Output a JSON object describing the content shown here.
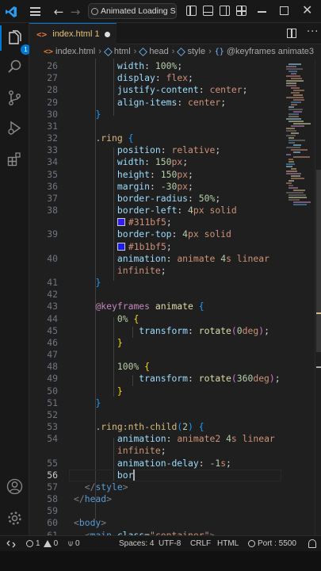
{
  "titlebar": {
    "search_text": "Animated Loading Scre"
  },
  "activity": {
    "explorer_badge": "1"
  },
  "tab": {
    "icon": "<>",
    "name": "index.html 1"
  },
  "breadcrumb": {
    "items": [
      "index.html",
      "html",
      "head",
      "style",
      "@keyframes animate3"
    ]
  },
  "editor": {
    "current_line": 56,
    "lines": [
      {
        "n": "26",
        "segs": [
          [
            "",
            "        "
          ],
          [
            "p",
            "width"
          ],
          [
            "pc",
            ": "
          ],
          [
            "n",
            "100"
          ],
          [
            "u",
            "%"
          ],
          [
            "pc",
            ";"
          ]
        ]
      },
      {
        "n": "27",
        "segs": [
          [
            "",
            "        "
          ],
          [
            "p",
            "display"
          ],
          [
            "pc",
            ": "
          ],
          [
            "v",
            "flex"
          ],
          [
            "pc",
            ";"
          ]
        ]
      },
      {
        "n": "28",
        "segs": [
          [
            "",
            "        "
          ],
          [
            "p",
            "justify-content"
          ],
          [
            "pc",
            ": "
          ],
          [
            "v",
            "center"
          ],
          [
            "pc",
            ";"
          ]
        ]
      },
      {
        "n": "29",
        "segs": [
          [
            "",
            "        "
          ],
          [
            "p",
            "align-items"
          ],
          [
            "pc",
            ": "
          ],
          [
            "v",
            "center"
          ],
          [
            "pc",
            ";"
          ]
        ]
      },
      {
        "n": "30",
        "segs": [
          [
            "",
            "    "
          ],
          [
            "b3",
            "}"
          ]
        ]
      },
      {
        "n": "31",
        "segs": []
      },
      {
        "n": "32",
        "segs": [
          [
            "",
            "    "
          ],
          [
            "sel",
            ".ring"
          ],
          [
            "pc",
            " "
          ],
          [
            "b3",
            "{"
          ]
        ]
      },
      {
        "n": "33",
        "segs": [
          [
            "",
            "        "
          ],
          [
            "p",
            "position"
          ],
          [
            "pc",
            ": "
          ],
          [
            "v",
            "relative"
          ],
          [
            "pc",
            ";"
          ]
        ]
      },
      {
        "n": "34",
        "segs": [
          [
            "",
            "        "
          ],
          [
            "p",
            "width"
          ],
          [
            "pc",
            ": "
          ],
          [
            "n",
            "150"
          ],
          [
            "v",
            "px"
          ],
          [
            "pc",
            ";"
          ]
        ]
      },
      {
        "n": "35",
        "segs": [
          [
            "",
            "        "
          ],
          [
            "p",
            "height"
          ],
          [
            "pc",
            ": "
          ],
          [
            "n",
            "150"
          ],
          [
            "v",
            "px"
          ],
          [
            "pc",
            ";"
          ]
        ]
      },
      {
        "n": "36",
        "segs": [
          [
            "",
            "        "
          ],
          [
            "p",
            "margin"
          ],
          [
            "pc",
            ": "
          ],
          [
            "n",
            "-30"
          ],
          [
            "v",
            "px"
          ],
          [
            "pc",
            ";"
          ]
        ]
      },
      {
        "n": "37",
        "segs": [
          [
            "",
            "        "
          ],
          [
            "p",
            "border-radius"
          ],
          [
            "pc",
            ": "
          ],
          [
            "n",
            "50"
          ],
          [
            "u",
            "%"
          ],
          [
            "pc",
            ";"
          ]
        ]
      },
      {
        "n": "38",
        "segs": [
          [
            "",
            "        "
          ],
          [
            "p",
            "border-left"
          ],
          [
            "pc",
            ": "
          ],
          [
            "n",
            "4"
          ],
          [
            "v",
            "px"
          ],
          [
            "pc",
            " "
          ],
          [
            "v",
            "solid"
          ]
        ]
      },
      {
        "n": "",
        "segs": [
          [
            "",
            "        "
          ],
          [
            "swatch",
            "#311bf5"
          ],
          [
            "v",
            "#311bf5"
          ],
          [
            "pc",
            ";"
          ]
        ]
      },
      {
        "n": "39",
        "segs": [
          [
            "",
            "        "
          ],
          [
            "p",
            "border-top"
          ],
          [
            "pc",
            ": "
          ],
          [
            "n",
            "4"
          ],
          [
            "v",
            "px"
          ],
          [
            "pc",
            " "
          ],
          [
            "v",
            "solid"
          ]
        ]
      },
      {
        "n": "",
        "segs": [
          [
            "",
            "        "
          ],
          [
            "swatch",
            "#1b1bf5"
          ],
          [
            "v",
            "#1b1bf5"
          ],
          [
            "pc",
            ";"
          ]
        ]
      },
      {
        "n": "40",
        "segs": [
          [
            "",
            "        "
          ],
          [
            "p",
            "animation"
          ],
          [
            "pc",
            ": "
          ],
          [
            "v",
            "animate"
          ],
          [
            "pc",
            " "
          ],
          [
            "n",
            "4"
          ],
          [
            "v",
            "s"
          ],
          [
            "pc",
            " "
          ],
          [
            "v",
            "linear"
          ]
        ]
      },
      {
        "n": "",
        "segs": [
          [
            "",
            "        "
          ],
          [
            "v",
            "infinite"
          ],
          [
            "pc",
            ";"
          ]
        ]
      },
      {
        "n": "41",
        "segs": [
          [
            "",
            "    "
          ],
          [
            "b3",
            "}"
          ]
        ]
      },
      {
        "n": "42",
        "segs": []
      },
      {
        "n": "43",
        "segs": [
          [
            "",
            "    "
          ],
          [
            "kw",
            "@keyframes"
          ],
          [
            "pc",
            " "
          ],
          [
            "fn",
            "animate"
          ],
          [
            "pc",
            " "
          ],
          [
            "b3",
            "{"
          ]
        ]
      },
      {
        "n": "44",
        "segs": [
          [
            "",
            "        "
          ],
          [
            "n",
            "0"
          ],
          [
            "u",
            "%"
          ],
          [
            "pc",
            " "
          ],
          [
            "b1",
            "{"
          ]
        ]
      },
      {
        "n": "45",
        "segs": [
          [
            "",
            "            "
          ],
          [
            "p",
            "transform"
          ],
          [
            "pc",
            ": "
          ],
          [
            "fn",
            "rotate"
          ],
          [
            "b2",
            "("
          ],
          [
            "n",
            "0"
          ],
          [
            "v",
            "deg"
          ],
          [
            "b2",
            ")"
          ],
          [
            "pc",
            ";"
          ]
        ]
      },
      {
        "n": "46",
        "segs": [
          [
            "",
            "        "
          ],
          [
            "b1",
            "}"
          ]
        ]
      },
      {
        "n": "47",
        "segs": []
      },
      {
        "n": "48",
        "segs": [
          [
            "",
            "        "
          ],
          [
            "n",
            "100"
          ],
          [
            "u",
            "%"
          ],
          [
            "pc",
            " "
          ],
          [
            "b1",
            "{"
          ]
        ]
      },
      {
        "n": "49",
        "segs": [
          [
            "",
            "            "
          ],
          [
            "p",
            "transform"
          ],
          [
            "pc",
            ": "
          ],
          [
            "fn",
            "rotate"
          ],
          [
            "b2",
            "("
          ],
          [
            "n",
            "360"
          ],
          [
            "v",
            "deg"
          ],
          [
            "b2",
            ")"
          ],
          [
            "pc",
            ";"
          ]
        ]
      },
      {
        "n": "50",
        "segs": [
          [
            "",
            "        "
          ],
          [
            "b1",
            "}"
          ]
        ]
      },
      {
        "n": "51",
        "segs": [
          [
            "",
            "    "
          ],
          [
            "b3",
            "}"
          ]
        ]
      },
      {
        "n": "52",
        "segs": []
      },
      {
        "n": "53",
        "segs": [
          [
            "",
            "    "
          ],
          [
            "sel",
            ".ring:nth-child"
          ],
          [
            "b3",
            "("
          ],
          [
            "n",
            "2"
          ],
          [
            "b3",
            ")"
          ],
          [
            "pc",
            " "
          ],
          [
            "b3",
            "{"
          ]
        ]
      },
      {
        "n": "54",
        "segs": [
          [
            "",
            "        "
          ],
          [
            "p",
            "animation"
          ],
          [
            "pc",
            ": "
          ],
          [
            "v",
            "animate2"
          ],
          [
            "pc",
            " "
          ],
          [
            "n",
            "4"
          ],
          [
            "v",
            "s"
          ],
          [
            "pc",
            " "
          ],
          [
            "v",
            "linear"
          ]
        ]
      },
      {
        "n": "",
        "segs": [
          [
            "",
            "        "
          ],
          [
            "v",
            "infinite"
          ],
          [
            "pc",
            ";"
          ]
        ]
      },
      {
        "n": "55",
        "segs": [
          [
            "",
            "        "
          ],
          [
            "p",
            "animation-delay"
          ],
          [
            "pc",
            ": "
          ],
          [
            "n",
            "-1"
          ],
          [
            "v",
            "s"
          ],
          [
            "pc",
            ";"
          ]
        ]
      },
      {
        "n": "56",
        "segs": [
          [
            "",
            "        "
          ],
          [
            "p",
            "bor"
          ],
          [
            "caret",
            ""
          ]
        ]
      },
      {
        "n": "57",
        "segs": [
          [
            "",
            "  "
          ],
          [
            "tag",
            "</"
          ],
          [
            "tn",
            "style"
          ],
          [
            "tag",
            ">"
          ]
        ]
      },
      {
        "n": "58",
        "segs": [
          [
            "tag",
            "</"
          ],
          [
            "tn",
            "head"
          ],
          [
            "tag",
            ">"
          ]
        ]
      },
      {
        "n": "59",
        "segs": []
      },
      {
        "n": "60",
        "segs": [
          [
            "tag",
            "<"
          ],
          [
            "tn",
            "body"
          ],
          [
            "tag",
            ">"
          ]
        ]
      },
      {
        "n": "61",
        "segs": [
          [
            "",
            "  "
          ],
          [
            "tag",
            "<"
          ],
          [
            "tn",
            "main"
          ],
          [
            "pc",
            " "
          ],
          [
            "at",
            "class"
          ],
          [
            "pc",
            "="
          ],
          [
            "str",
            "\"container\""
          ],
          [
            "tag",
            ">"
          ]
        ]
      }
    ]
  },
  "statusbar": {
    "errors": "1",
    "warnings": "0",
    "remote_count": "0",
    "spaces": "Spaces: 4",
    "encoding": "UTF-8",
    "eol": "CRLF",
    "language": "HTML",
    "port": "Port : 5500"
  },
  "colors": {
    "accent": "#0078d4",
    "swatch1": "#311bf5",
    "swatch2": "#1b1bf5"
  }
}
